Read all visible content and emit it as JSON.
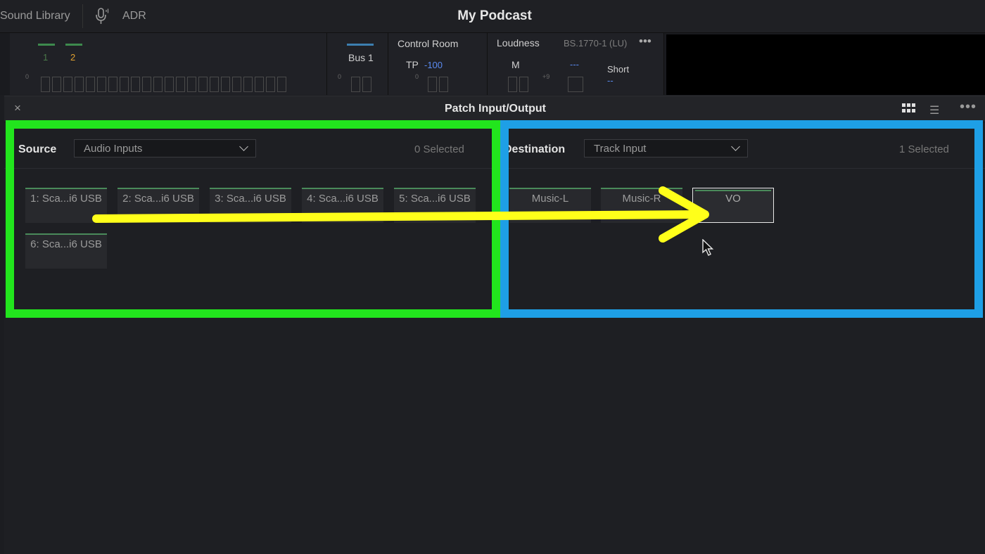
{
  "topbar": {
    "sound_library": "Sound Library",
    "adr": "ADR",
    "project_title": "My Podcast"
  },
  "meters": {
    "track_numbers": [
      "1",
      "2"
    ],
    "bus_label": "Bus 1",
    "control_room": "Control Room",
    "tp_label": "TP",
    "tp_value": "-100",
    "loudness": "Loudness",
    "loudness_standard": "BS.1770-1 (LU)",
    "m_label": "M",
    "m_value": "---",
    "short_label": "Short",
    "short_value": "--",
    "scale_zero": "0",
    "scale_plus9": "+9",
    "more": "•••"
  },
  "patch": {
    "title": "Patch Input/Output",
    "close": "×",
    "more": "•••",
    "source": {
      "label": "Source",
      "dropdown": "Audio Inputs",
      "selected": "0 Selected",
      "items": [
        "1: Sca...i6 USB",
        "2: Sca...i6 USB",
        "3: Sca...i6 USB",
        "4: Sca...i6 USB",
        "5: Sca...i6 USB",
        "6: Sca...i6 USB"
      ]
    },
    "destination": {
      "label": "Destination",
      "dropdown": "Track Input",
      "selected": "1 Selected",
      "items": [
        "Music-L",
        "Music-R",
        "VO"
      ]
    }
  },
  "colors": {
    "source_highlight": "#22e51d",
    "destination_highlight": "#1e9fe6",
    "arrow": "#ffff1a",
    "track2_accent": "#e0a030",
    "meter_blue": "#5a8af0"
  },
  "icons": [
    "microphone-icon",
    "close-icon",
    "grid-view-icon",
    "list-view-icon",
    "more-icon",
    "chevron-down-icon",
    "cursor-icon"
  ]
}
